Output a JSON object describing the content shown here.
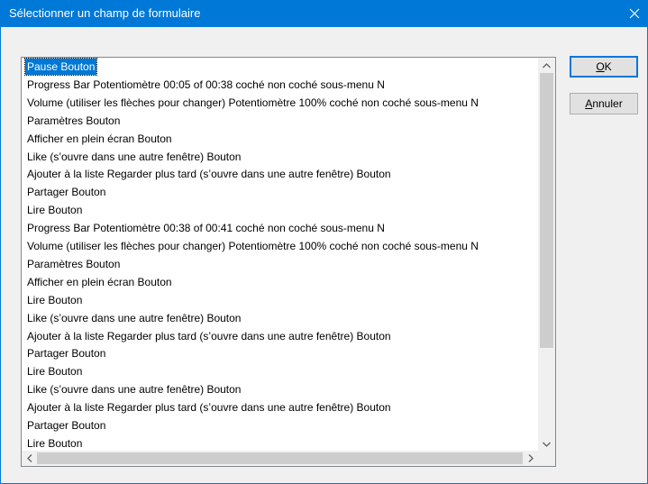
{
  "window": {
    "title": "Sélectionner un champ de formulaire",
    "close_glyph": "✕"
  },
  "list": {
    "selected_index": 0,
    "items": [
      "Pause Bouton",
      "Progress Bar Potentiomètre 00:05 of 00:38  coché  non coché  sous-menu N",
      "Volume (utiliser les flèches pour changer) Potentiomètre 100%  coché  non coché  sous-menu N",
      "Paramètres Bouton",
      "Afficher en plein écran Bouton",
      "Like (s’ouvre dans une autre fenêtre) Bouton",
      "Ajouter à la liste Regarder plus tard (s’ouvre dans une autre fenêtre) Bouton",
      "Partager Bouton",
      "Lire Bouton",
      "Progress Bar Potentiomètre 00:38 of 00:41  coché  non coché  sous-menu N",
      "Volume (utiliser les flèches pour changer) Potentiomètre 100%  coché  non coché  sous-menu N",
      "Paramètres Bouton",
      "Afficher en plein écran Bouton",
      "Lire Bouton",
      "Like (s’ouvre dans une autre fenêtre) Bouton",
      "Ajouter à la liste Regarder plus tard (s’ouvre dans une autre fenêtre) Bouton",
      "Partager Bouton",
      "Lire Bouton",
      "Like (s’ouvre dans une autre fenêtre) Bouton",
      "Ajouter à la liste Regarder plus tard (s’ouvre dans une autre fenêtre) Bouton",
      "Partager Bouton",
      "Lire Bouton"
    ]
  },
  "buttons": {
    "ok": {
      "mnemonic": "O",
      "rest": "K"
    },
    "cancel": {
      "mnemonic": "A",
      "rest": "nnuler"
    }
  },
  "colors": {
    "titlebar": "#0078d7",
    "selection": "#0078d7"
  }
}
